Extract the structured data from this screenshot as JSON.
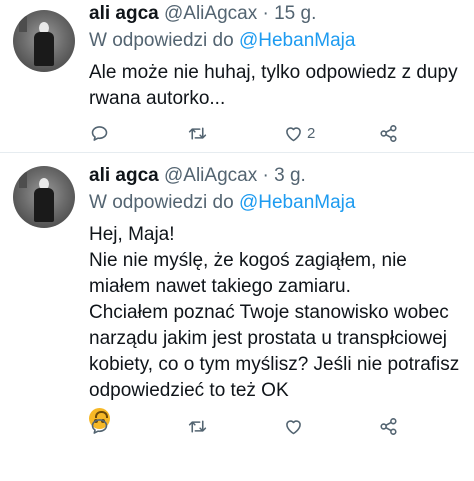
{
  "tweets": [
    {
      "author_name": "ali agca",
      "handle": "@AliAgcax",
      "separator": "·",
      "time": "15 g.",
      "reply_prefix": "W odpowiedzi do",
      "reply_to": "@HebanMaja",
      "text_lines": [
        "Ale może nie huhaj, tylko odpowiedz z dupy rwana autorko..."
      ],
      "likes": "2",
      "emoji": ""
    },
    {
      "author_name": "ali agca",
      "handle": "@AliAgcax",
      "separator": "·",
      "time": "3 g.",
      "reply_prefix": "W odpowiedzi do",
      "reply_to": "@HebanMaja",
      "text_lines": [
        "Hej, Maja!",
        "Nie nie myślę, że kogoś zagiąłem, nie miałem nawet takiego zamiaru.",
        "Chciałem poznać Twoje stanowisko wobec narządu jakim jest prostata u transpłciowej kobiety, co o tym myślisz? Jeśli nie potrafisz odpowiedzieć to też OK"
      ],
      "likes": "",
      "emoji": "upside-down-face-emoji"
    }
  ],
  "icons": {
    "reply": "reply-icon",
    "retweet": "retweet-icon",
    "like": "heart-icon",
    "share": "share-icon"
  },
  "colors": {
    "text": "#0f1419",
    "secondary": "#536471",
    "mention": "#1d9bf0",
    "divider": "#e6ecf0"
  }
}
